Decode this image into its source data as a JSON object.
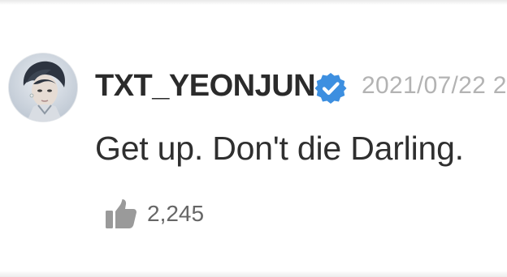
{
  "post": {
    "author": "TXT_YEONJUN",
    "timestamp": "2021/07/22 2",
    "message": "Get up. Don't die Darling.",
    "likes": "2,245"
  },
  "icons": {
    "verified": "verified-badge-icon",
    "like": "thumbs-up-icon",
    "avatar": "profile-avatar"
  },
  "colors": {
    "verified_badge": "#3d8fe0",
    "author_text": "#2b2b2b",
    "timestamp_text": "#b3b3b3",
    "message_text": "#2f2f2f",
    "like_icon": "#9a9a9a",
    "like_count": "#666666"
  }
}
